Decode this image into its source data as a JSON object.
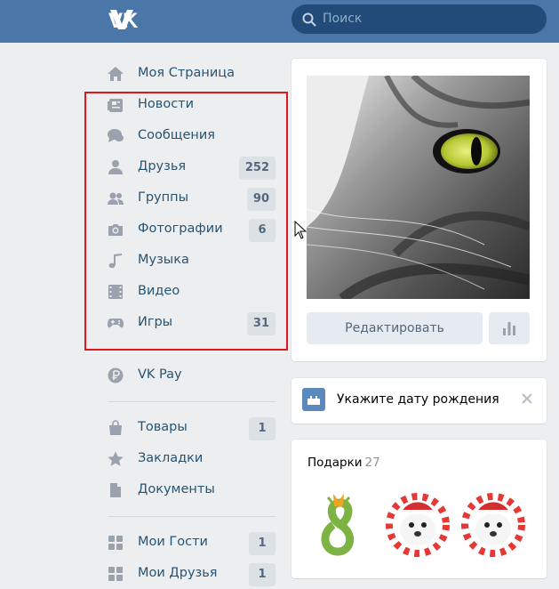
{
  "header": {
    "logo": "VK",
    "search_placeholder": "Поиск"
  },
  "menu": {
    "items": [
      {
        "label": "Моя Страница",
        "icon": "home-icon",
        "badge": null
      },
      {
        "label": "Новости",
        "icon": "news-icon",
        "badge": null
      },
      {
        "label": "Сообщения",
        "icon": "messages-icon",
        "badge": null
      },
      {
        "label": "Друзья",
        "icon": "friends-icon",
        "badge": "252"
      },
      {
        "label": "Группы",
        "icon": "groups-icon",
        "badge": "90"
      },
      {
        "label": "Фотографии",
        "icon": "camera-icon",
        "badge": "6"
      },
      {
        "label": "Музыка",
        "icon": "music-icon",
        "badge": null
      },
      {
        "label": "Видео",
        "icon": "video-icon",
        "badge": null
      },
      {
        "label": "Игры",
        "icon": "gamepad-icon",
        "badge": "31"
      },
      {
        "label": "VK Pay",
        "icon": "vkpay-icon",
        "badge": null
      },
      {
        "label": "Товары",
        "icon": "bag-icon",
        "badge": "1"
      },
      {
        "label": "Закладки",
        "icon": "star-icon",
        "badge": null
      },
      {
        "label": "Документы",
        "icon": "document-icon",
        "badge": null
      },
      {
        "label": "Мои Гости",
        "icon": "app-grid-icon",
        "badge": "1"
      },
      {
        "label": "Мои Друзья",
        "icon": "app-grid-icon",
        "badge": "1"
      }
    ]
  },
  "profile": {
    "edit_label": "Редактировать"
  },
  "birthday": {
    "text": "Укажите дату рождения"
  },
  "gifts": {
    "title": "Подарки",
    "count": "27"
  },
  "colors": {
    "header_bg": "#4a76a8",
    "menu_text": "#285473",
    "icon": "#99a2ad",
    "highlight": "#e0181e"
  }
}
